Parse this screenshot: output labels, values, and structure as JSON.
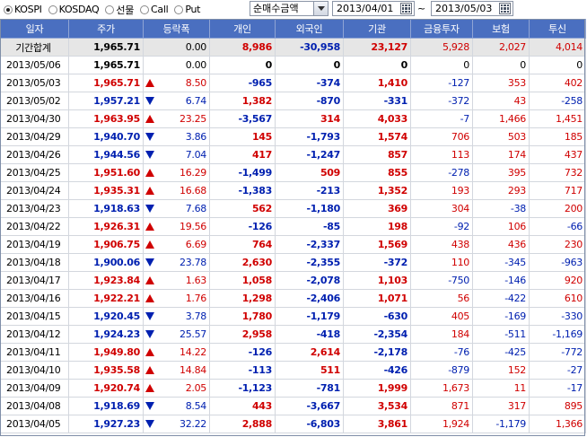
{
  "toolbar": {
    "markets": [
      {
        "label": "KOSPI",
        "checked": true
      },
      {
        "label": "KOSDAQ",
        "checked": false
      },
      {
        "label": "선물",
        "checked": false
      },
      {
        "label": "Call",
        "checked": false
      },
      {
        "label": "Put",
        "checked": false
      }
    ],
    "mode_select": "순매수금액",
    "date_from": "2013/04/01",
    "date_to": "2013/05/03",
    "range_sep": "~"
  },
  "columns": [
    "일자",
    "주가",
    "등락폭",
    "개인",
    "외국인",
    "기관",
    "금융투자",
    "보험",
    "투신"
  ],
  "summary": {
    "date": "기간합계",
    "price": "1,965.71",
    "change": "0.00",
    "dir": "",
    "indiv": "8,986",
    "foreign": "-30,958",
    "inst": "23,127",
    "fin": "5,928",
    "ins": "2,027",
    "trust": "4,014"
  },
  "rows": [
    {
      "date": "2013/05/06",
      "price": "1,965.71",
      "change": "0.00",
      "dir": "",
      "indiv": "0",
      "foreign": "0",
      "inst": "0",
      "fin": "0",
      "ins": "0",
      "trust": "0"
    },
    {
      "date": "2013/05/03",
      "price": "1,965.71",
      "change": "8.50",
      "dir": "up",
      "indiv": "-965",
      "foreign": "-374",
      "inst": "1,410",
      "fin": "-127",
      "ins": "353",
      "trust": "402"
    },
    {
      "date": "2013/05/02",
      "price": "1,957.21",
      "change": "6.74",
      "dir": "down",
      "indiv": "1,382",
      "foreign": "-870",
      "inst": "-331",
      "fin": "-372",
      "ins": "43",
      "trust": "-258"
    },
    {
      "date": "2013/04/30",
      "price": "1,963.95",
      "change": "23.25",
      "dir": "up",
      "indiv": "-3,567",
      "foreign": "314",
      "inst": "4,033",
      "fin": "-7",
      "ins": "1,466",
      "trust": "1,451"
    },
    {
      "date": "2013/04/29",
      "price": "1,940.70",
      "change": "3.86",
      "dir": "down",
      "indiv": "145",
      "foreign": "-1,793",
      "inst": "1,574",
      "fin": "706",
      "ins": "503",
      "trust": "185"
    },
    {
      "date": "2013/04/26",
      "price": "1,944.56",
      "change": "7.04",
      "dir": "down",
      "indiv": "417",
      "foreign": "-1,247",
      "inst": "857",
      "fin": "113",
      "ins": "174",
      "trust": "437"
    },
    {
      "date": "2013/04/25",
      "price": "1,951.60",
      "change": "16.29",
      "dir": "up",
      "indiv": "-1,499",
      "foreign": "509",
      "inst": "855",
      "fin": "-278",
      "ins": "395",
      "trust": "732"
    },
    {
      "date": "2013/04/24",
      "price": "1,935.31",
      "change": "16.68",
      "dir": "up",
      "indiv": "-1,383",
      "foreign": "-213",
      "inst": "1,352",
      "fin": "193",
      "ins": "293",
      "trust": "717"
    },
    {
      "date": "2013/04/23",
      "price": "1,918.63",
      "change": "7.68",
      "dir": "down",
      "indiv": "562",
      "foreign": "-1,180",
      "inst": "369",
      "fin": "304",
      "ins": "-38",
      "trust": "200"
    },
    {
      "date": "2013/04/22",
      "price": "1,926.31",
      "change": "19.56",
      "dir": "up",
      "indiv": "-126",
      "foreign": "-85",
      "inst": "198",
      "fin": "-92",
      "ins": "106",
      "trust": "-66"
    },
    {
      "date": "2013/04/19",
      "price": "1,906.75",
      "change": "6.69",
      "dir": "up",
      "indiv": "764",
      "foreign": "-2,337",
      "inst": "1,569",
      "fin": "438",
      "ins": "436",
      "trust": "230"
    },
    {
      "date": "2013/04/18",
      "price": "1,900.06",
      "change": "23.78",
      "dir": "down",
      "indiv": "2,630",
      "foreign": "-2,355",
      "inst": "-372",
      "fin": "110",
      "ins": "-345",
      "trust": "-963"
    },
    {
      "date": "2013/04/17",
      "price": "1,923.84",
      "change": "1.63",
      "dir": "up",
      "indiv": "1,058",
      "foreign": "-2,078",
      "inst": "1,103",
      "fin": "-750",
      "ins": "-146",
      "trust": "920"
    },
    {
      "date": "2013/04/16",
      "price": "1,922.21",
      "change": "1.76",
      "dir": "up",
      "indiv": "1,298",
      "foreign": "-2,406",
      "inst": "1,071",
      "fin": "56",
      "ins": "-422",
      "trust": "610"
    },
    {
      "date": "2013/04/15",
      "price": "1,920.45",
      "change": "3.78",
      "dir": "down",
      "indiv": "1,780",
      "foreign": "-1,179",
      "inst": "-630",
      "fin": "405",
      "ins": "-169",
      "trust": "-330"
    },
    {
      "date": "2013/04/12",
      "price": "1,924.23",
      "change": "25.57",
      "dir": "down",
      "indiv": "2,958",
      "foreign": "-418",
      "inst": "-2,354",
      "fin": "184",
      "ins": "-511",
      "trust": "-1,169"
    },
    {
      "date": "2013/04/11",
      "price": "1,949.80",
      "change": "14.22",
      "dir": "up",
      "indiv": "-126",
      "foreign": "2,614",
      "inst": "-2,178",
      "fin": "-76",
      "ins": "-425",
      "trust": "-772"
    },
    {
      "date": "2013/04/10",
      "price": "1,935.58",
      "change": "14.84",
      "dir": "up",
      "indiv": "-113",
      "foreign": "511",
      "inst": "-426",
      "fin": "-879",
      "ins": "152",
      "trust": "-27"
    },
    {
      "date": "2013/04/09",
      "price": "1,920.74",
      "change": "2.05",
      "dir": "up",
      "indiv": "-1,123",
      "foreign": "-781",
      "inst": "1,999",
      "fin": "1,673",
      "ins": "11",
      "trust": "-17"
    },
    {
      "date": "2013/04/08",
      "price": "1,918.69",
      "change": "8.54",
      "dir": "down",
      "indiv": "443",
      "foreign": "-3,667",
      "inst": "3,534",
      "fin": "871",
      "ins": "317",
      "trust": "895"
    },
    {
      "date": "2013/04/05",
      "price": "1,927.23",
      "change": "32.22",
      "dir": "down",
      "indiv": "2,888",
      "foreign": "-6,803",
      "inst": "3,861",
      "fin": "1,924",
      "ins": "-1,179",
      "trust": "1,366"
    }
  ],
  "colors": {
    "header_bg": "#4a6fc0",
    "up": "#d00000",
    "down": "#0020b0",
    "summary_bg": "#e6e6e6"
  }
}
